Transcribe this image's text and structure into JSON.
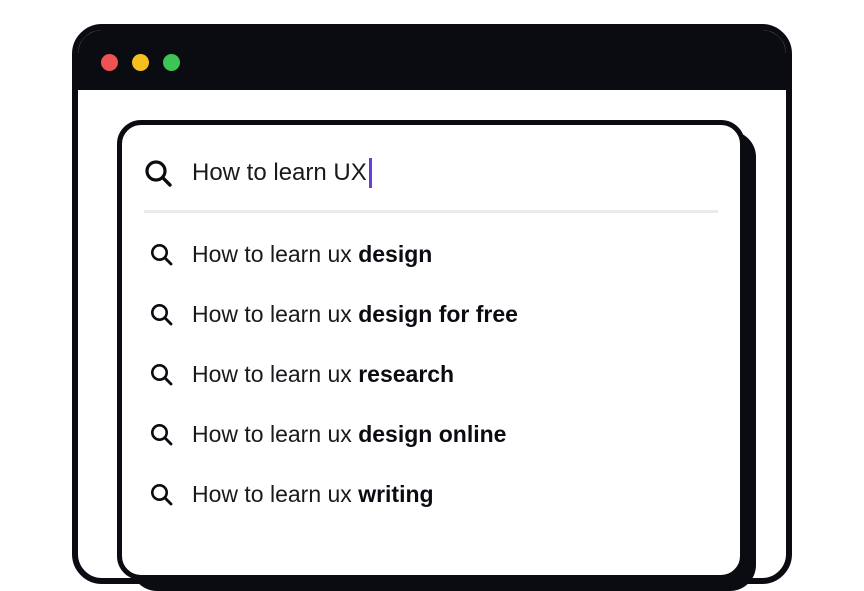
{
  "window": {
    "controls": [
      {
        "name": "close",
        "color": "#ef5253"
      },
      {
        "name": "minimize",
        "color": "#f5bf1d"
      },
      {
        "name": "maximize",
        "color": "#3ec456"
      }
    ],
    "titlebar_color": "#0b0b12"
  },
  "search": {
    "icon": "search-icon",
    "query": "How to learn UX",
    "caret_color": "#6a3cd8"
  },
  "suggestions": [
    {
      "prefix": "How to learn ux ",
      "completion": "design",
      "icon": "search-icon"
    },
    {
      "prefix": "How to learn ux ",
      "completion": "design for free",
      "icon": "search-icon"
    },
    {
      "prefix": "How to learn ux ",
      "completion": "research",
      "icon": "search-icon"
    },
    {
      "prefix": "How to learn ux ",
      "completion": "design online",
      "icon": "search-icon"
    },
    {
      "prefix": "How to learn ux ",
      "completion": "writing",
      "icon": "search-icon"
    }
  ]
}
